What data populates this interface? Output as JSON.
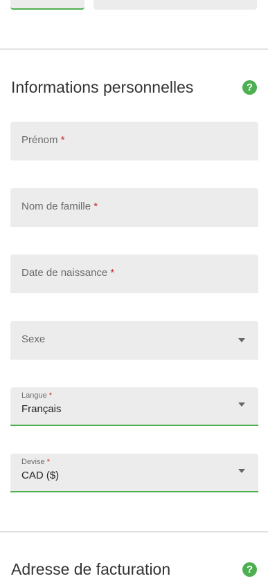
{
  "sections": {
    "personal": {
      "title": "Informations personnelles",
      "help": "?"
    },
    "billing": {
      "title": "Adresse de facturation",
      "help": "?"
    }
  },
  "fields": {
    "first_name": {
      "label": "Prénom",
      "required": "*"
    },
    "last_name": {
      "label": "Nom de famille",
      "required": "*"
    },
    "birth_date": {
      "label": "Date de naissance",
      "required": "*"
    },
    "gender": {
      "label": "Sexe"
    },
    "language": {
      "label": "Langue",
      "required": "*",
      "value": "Français"
    },
    "currency": {
      "label": "Devise",
      "required": "*",
      "value": "CAD ($)"
    }
  },
  "colors": {
    "accent": "#4caf50",
    "required": "#c62828",
    "field_bg": "#ececec"
  }
}
